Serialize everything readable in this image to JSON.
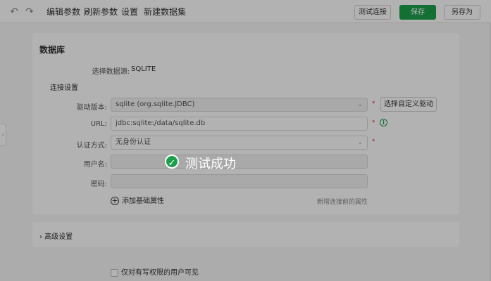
{
  "toolbar": {
    "undo_icon": "undo-icon",
    "redo_icon": "redo-icon",
    "menu": [
      "编辑参数",
      "刷新参数",
      "设置",
      "新建数据集"
    ],
    "test_connection": "测试连接",
    "save": "保存",
    "save_as": "另存为"
  },
  "database_section": {
    "title": "数据库",
    "datasource_label": "选择数据源:",
    "datasource_value": "SQLITE",
    "connection_title": "连接设置",
    "driver_label": "驱动版本:",
    "driver_value": "sqlite (org.sqlite.JDBC)",
    "custom_driver_button": "选择自定义驱动",
    "url_label": "URL:",
    "url_value": "jdbc:sqlite:/data/sqlite.db",
    "auth_label": "认证方式:",
    "auth_value": "无身份认证",
    "username_label": "用户名:",
    "username_value": "",
    "password_label": "密码:",
    "password_value": "",
    "add_property": "添加基础属性",
    "hint": "新增连接前的属性",
    "required_mark": "*",
    "info_icon": "i"
  },
  "advanced_section": {
    "title": "高级设置"
  },
  "visibility_option": {
    "label": "仅对有写权限的用户可见",
    "checked": false
  },
  "toast": {
    "message": "测试成功",
    "icon": "check-circle-icon",
    "color": "#1c9f4a"
  },
  "colors": {
    "accent": "#1c9f4a",
    "required": "#e23a3a"
  }
}
